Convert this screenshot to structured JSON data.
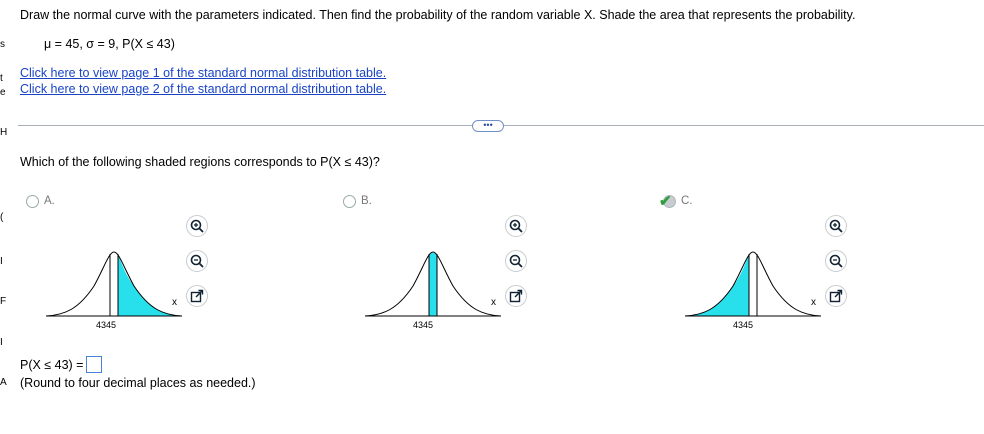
{
  "question": "Draw the normal curve with the parameters indicated. Then find the probability of the random variable X. Shade the area that represents the probability.",
  "params": "μ = 45, σ = 9, P(X ≤ 43)",
  "links": [
    "Click here to view page 1 of the standard normal distribution table.",
    "Click here to view page 2 of the standard normal distribution table."
  ],
  "more_label": "•••",
  "subquestion": "Which of the following shaded regions corresponds to P(X ≤ 43)?",
  "options": [
    {
      "label": "A.",
      "shade": "right",
      "tick": "4345",
      "selected": false
    },
    {
      "label": "B.",
      "shade": "between",
      "tick": "4345",
      "selected": false
    },
    {
      "label": "C.",
      "shade": "left",
      "tick": "4345",
      "selected": true
    }
  ],
  "axis_label": "x",
  "answer_label": "P(X ≤ 43) =",
  "note": "(Round to four decimal places as needed.)",
  "colors": {
    "shade": "#27e0ec",
    "link": "#1a44c8",
    "check": "#2e9d3a"
  },
  "edge_letters": [
    "s",
    "t",
    "e",
    "H",
    "(",
    "I",
    "F",
    "I",
    "A"
  ]
}
